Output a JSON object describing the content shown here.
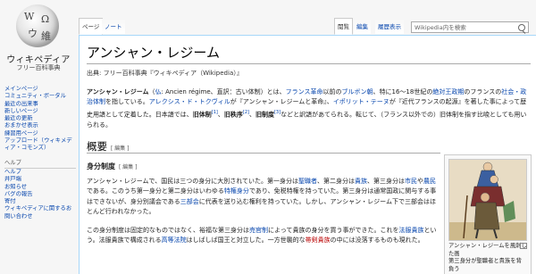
{
  "logo": {
    "title": "ウィキペディア",
    "subtitle": "フリー百科事典",
    "glyphs": [
      "W",
      "Ω",
      "ウ",
      "維"
    ]
  },
  "sidebar": {
    "main": [
      "メインページ",
      "コミュニティ・ポータル",
      "最近の出来事",
      "新しいページ",
      "最近の更新",
      "おまかせ表示",
      "練習用ページ",
      "アップロード（ウィキメディア・コモンズ）"
    ],
    "help_header": "ヘルプ",
    "help": [
      "ヘルプ",
      "井戸端",
      "お知らせ",
      "バグの報告",
      "寄付",
      "ウィキペディアに関するお問い合わせ"
    ]
  },
  "tabs": {
    "page": "ページ",
    "talk": "ノート",
    "read": "閲覧",
    "edit": "編集",
    "history": "履歴表示"
  },
  "search": {
    "placeholder": "Wikipedia内を検索"
  },
  "article": {
    "title": "アンシャン・レジーム",
    "from": "出典: フリー百科事典『ウィキペディア（Wikipedia）』",
    "intro": {
      "t1": "アンシャン・レジーム",
      "t2": "（",
      "t3": "仏",
      "t4": ": Ancien régime、直訳：古い体制）とは、",
      "t5": "フランス革命",
      "t6": "以前の",
      "t7": "ブルボン朝",
      "t8": "、特に16〜18世紀の",
      "t9": "絶対王政期",
      "t10": "のフランスの",
      "t11": "社会・政治体制",
      "t12": "を指している。",
      "t13": "アレクシス・ド・トクヴィル",
      "t14": "が『アンシャン・レジームと革命』、",
      "t15": "イポリット・テーヌ",
      "t16": "が『近代フランスの起源』を著した事によって歴史用語として定着した。日本語では、",
      "t17": "旧体制",
      "t18": "[1]",
      "t19": "、",
      "t20": "旧秩序",
      "t21": "[2]",
      "t22": "、",
      "t23": "旧制度",
      "t24": "[3]",
      "t25": "などと訳語があてられる。転じて、（フランス以外での）旧体制を指す比喩としても用いられる。"
    },
    "h2": "概要",
    "edit_label": "[ 編集 ]",
    "h3": "身分制度",
    "p2": {
      "a1": "アンシャン・レジームで、国民は三つの身分に大別されていた。第一身分は",
      "a2": "聖職者",
      "a3": "、第二身分は",
      "a4": "貴族",
      "a5": "、第三身分は",
      "a6": "市民",
      "a7": "や",
      "a8": "農民",
      "a9": "である。このうち第一身分と第二身分はいわゆる",
      "a10": "特権身分",
      "a11": "であり、免税特権を持っていた。第三身分は通常国政に関与する事はできないが、身分別議会である",
      "a12": "三部会",
      "a13": "に代表を送り込む権利を持っていた。しかし、アンシャン・レジーム下で三部会はほとんど行われなかった。"
    },
    "p3": {
      "b1": "この身分制度は固定的なものではなく、裕福な第三身分は",
      "b2": "売官制",
      "b3": "によって貴族の身分を買う事ができた。これを",
      "b4": "法服貴族",
      "b5": "という。法服貴族で構成される",
      "b6": "高等法院",
      "b7": "はしばしば国王と対立した。一方世襲的な",
      "b8": "帯剣貴族",
      "b9": "の中には没落するものも現れた。"
    },
    "caption": "アンシャン・レジームを風刺した画\n第三身分が聖職者と貴族を背負う"
  },
  "colors": {
    "link": "#0645ad",
    "redlink": "#ba0000",
    "border": "#a7d7f9"
  }
}
